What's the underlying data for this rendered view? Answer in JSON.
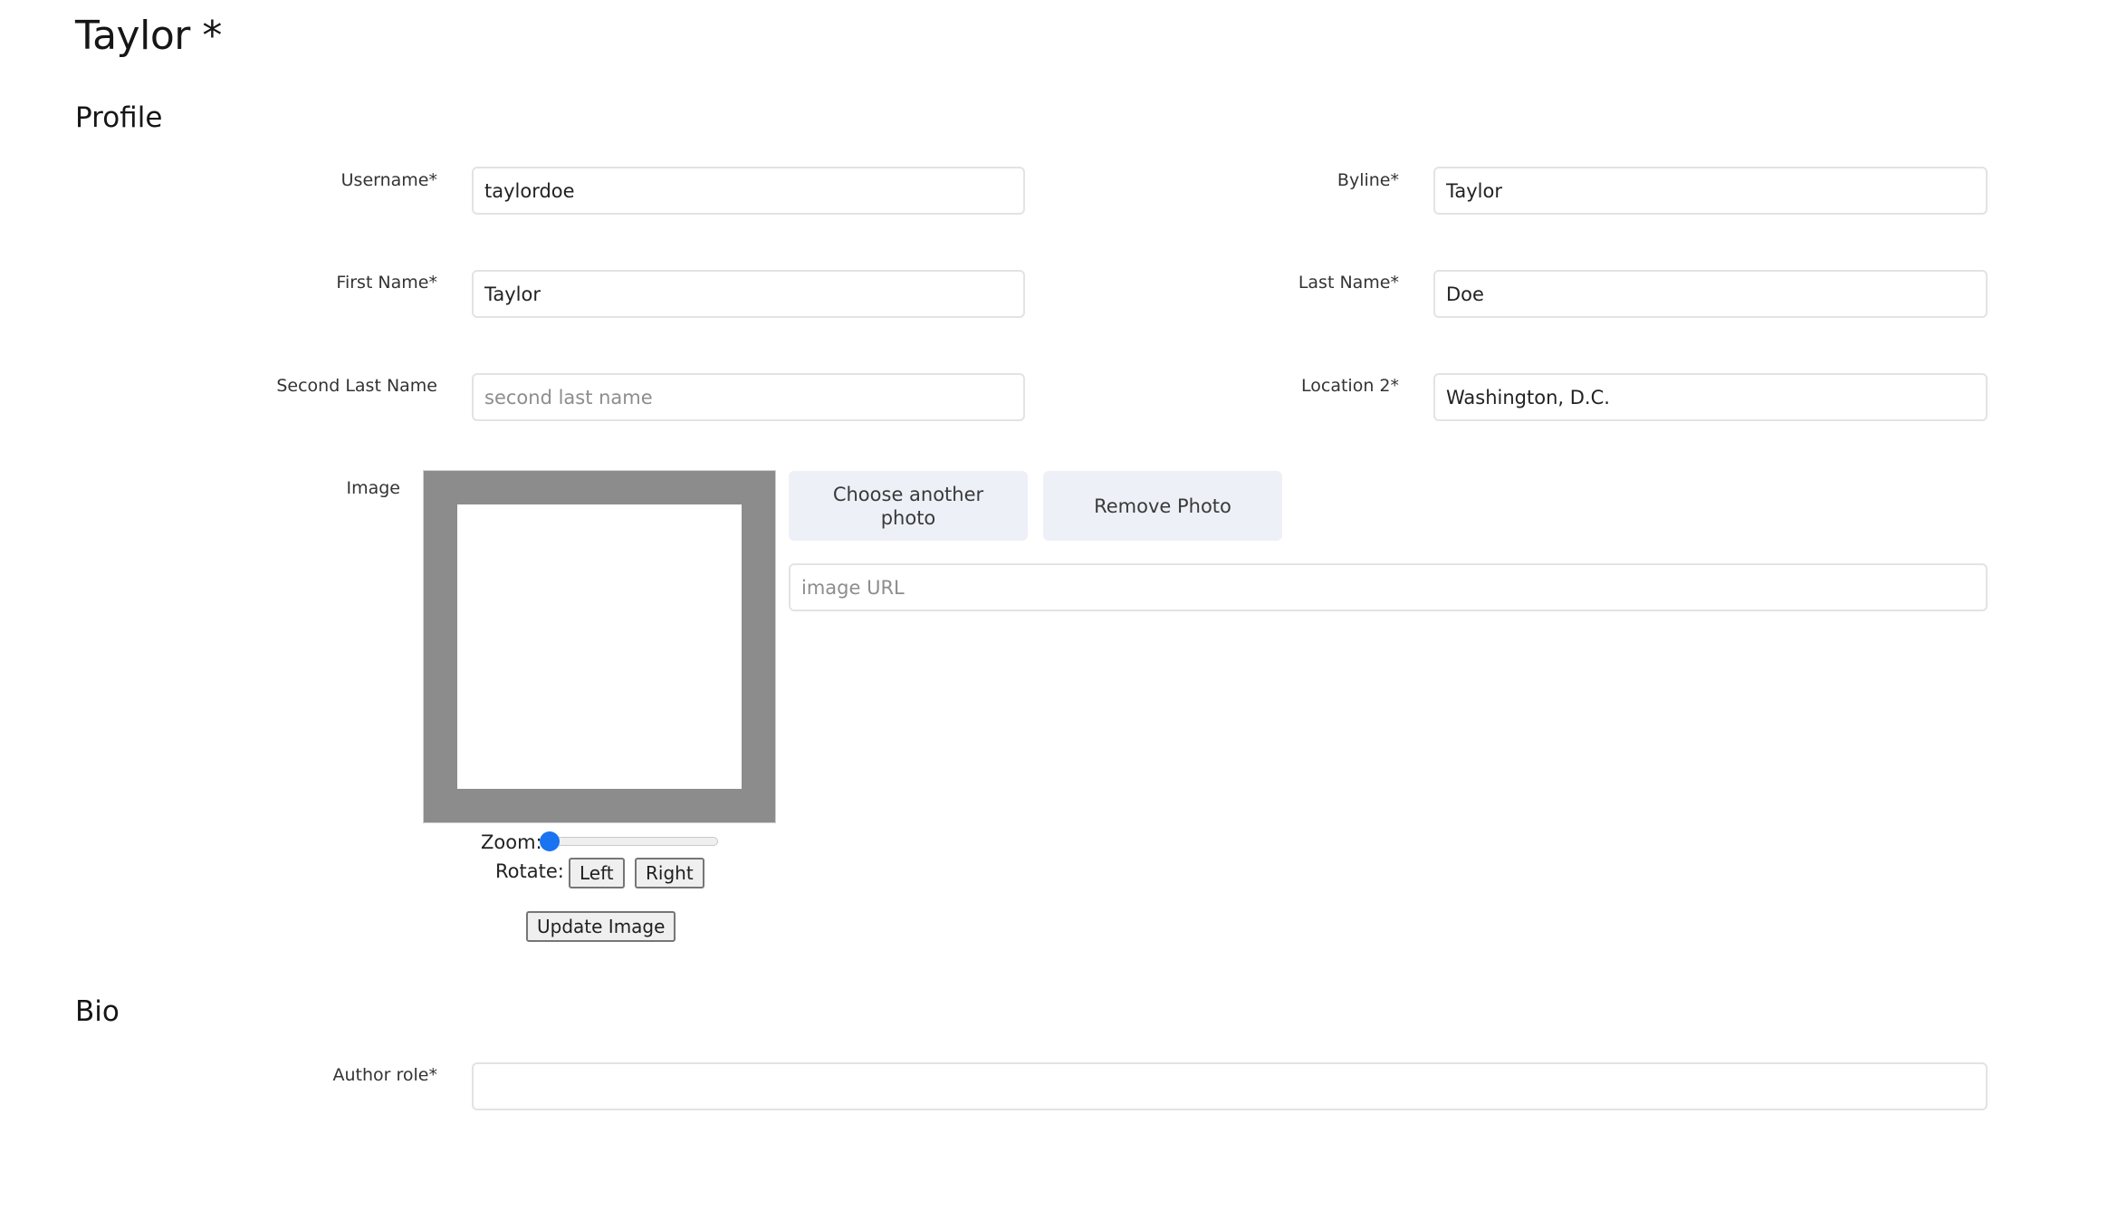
{
  "page": {
    "title": "Taylor *"
  },
  "profile": {
    "section_title": "Profile",
    "fields": {
      "username": {
        "label": "Username*",
        "value": "taylordoe",
        "placeholder": ""
      },
      "byline": {
        "label": "Byline*",
        "value": "Taylor",
        "placeholder": ""
      },
      "first_name": {
        "label": "First Name*",
        "value": "Taylor",
        "placeholder": ""
      },
      "last_name": {
        "label": "Last Name*",
        "value": "Doe",
        "placeholder": ""
      },
      "second_last_name": {
        "label": "Second Last Name",
        "value": "",
        "placeholder": "second last name"
      },
      "location2": {
        "label": "Location 2*",
        "value": "Washington, D.C.",
        "placeholder": ""
      }
    },
    "image": {
      "label": "Image",
      "choose_button": "Choose another photo",
      "remove_button": "Remove Photo",
      "url_placeholder": "image URL",
      "url_value": "",
      "zoom_label": "Zoom:",
      "zoom_value_fraction": 0.0,
      "rotate_label": "Rotate:",
      "rotate_left": "Left",
      "rotate_right": "Right",
      "update_button": "Update Image"
    }
  },
  "bio": {
    "section_title": "Bio",
    "author_role": {
      "label": "Author role*",
      "value": "",
      "placeholder": ""
    }
  },
  "colors": {
    "frame": "#8c8c8c",
    "soft_button_bg": "#edf0f6",
    "slider_accent": "#1a73f0",
    "field_border": "#e3e3e3"
  }
}
